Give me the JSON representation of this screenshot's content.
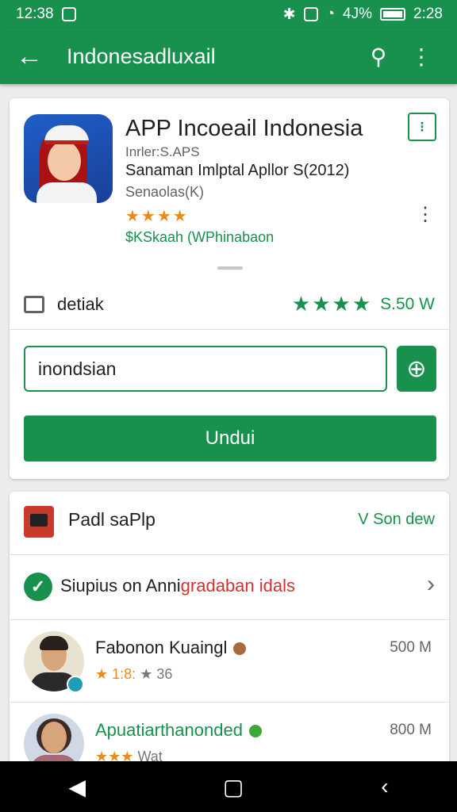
{
  "status": {
    "time_left": "12:38",
    "signal_text": "4J%",
    "time_right": "2:28"
  },
  "appbar": {
    "back_glyph": "←",
    "title": "Indonesadluxail",
    "search_glyph": "⚲",
    "menu_glyph": "⋮"
  },
  "app": {
    "title": "APP Incoeail Indonesia",
    "developer": "Inrler:S.APS",
    "meta1": "Sanaman Imlptal Apllor S(2012)",
    "meta2": "Senaolas(K)",
    "stars": "★★★★",
    "price": "$KSkaah (WPhinabaon",
    "overflow_glyph": "⋮"
  },
  "detail": {
    "label": "detiak",
    "stars": "★★★★",
    "size": "S.50 W"
  },
  "search": {
    "value": "inondsian"
  },
  "install": {
    "label": "Undui",
    "add_glyph": "⊕"
  },
  "section": {
    "title": "Padl saPlp",
    "action": "V Son dew"
  },
  "notice": {
    "text_black": "Siupius on Anni",
    "text_red": "gradaban idals",
    "chevron": "›"
  },
  "reviews": [
    {
      "name": "Fabonon Kuaingl",
      "stars": "★ 1:8:",
      "rating_text": "★ 36",
      "size": "500 M"
    },
    {
      "name": "Apuatiarthanonded",
      "stars": "★★★",
      "rating_text": "Wat",
      "size": "800 M"
    }
  ],
  "navbar": {
    "back": "◀",
    "home": "▢",
    "recent": "‹"
  },
  "colors": {
    "accent": "#17914d",
    "star": "#ea8a1c",
    "warning": "#d33131"
  }
}
